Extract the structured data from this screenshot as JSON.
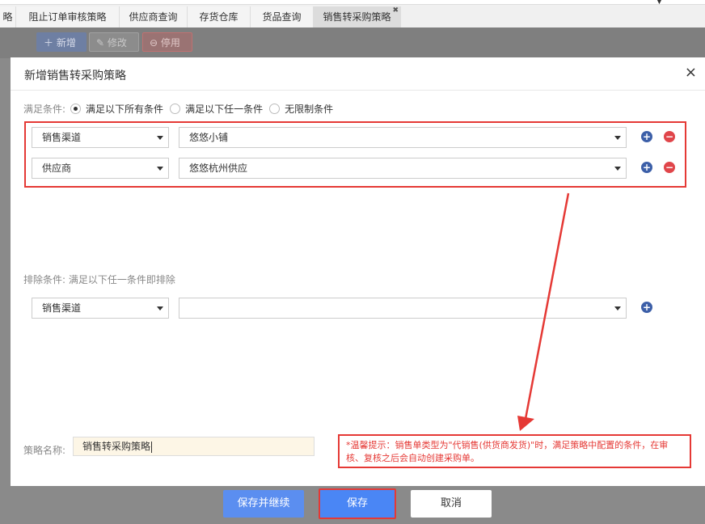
{
  "tabs": [
    {
      "label": "略"
    },
    {
      "label": "阻止订单审核策略"
    },
    {
      "label": "供应商查询"
    },
    {
      "label": "存货仓库"
    },
    {
      "label": "货品查询"
    },
    {
      "label": "销售转采购策略",
      "active": true
    }
  ],
  "toolbar": {
    "add_label": "新增",
    "edit_label": "修改",
    "stop_label": "停用"
  },
  "dialog": {
    "title": "新增销售转采购策略",
    "close_glyph": "×",
    "condition_label": "满足条件:",
    "condition_options": [
      "满足以下所有条件",
      "满足以下任一条件",
      "无限制条件"
    ],
    "condition_selected": "满足以下所有条件",
    "conditions": [
      {
        "field": "销售渠道",
        "value": "悠悠小铺"
      },
      {
        "field": "供应商",
        "value": "悠悠杭州供应"
      }
    ],
    "exclude_label": "排除条件:",
    "exclude_hint": "满足以下任一条件即排除",
    "exclusions": [
      {
        "field": "销售渠道",
        "value": ""
      }
    ],
    "name_label": "策略名称:",
    "name_value": "销售转采购策略",
    "tip": "*温馨提示：销售单类型为\"代销售(供货商发货)\"时，满足策略中配置的条件，在审核、复核之后会自动创建采购单。",
    "buttons": {
      "save_continue": "保存并继续",
      "save": "保存",
      "cancel": "取消"
    }
  },
  "colors": {
    "highlight": "#e53935",
    "primary": "#4a86f5",
    "plus": "#3c5fa8",
    "minus": "#e0454a"
  }
}
